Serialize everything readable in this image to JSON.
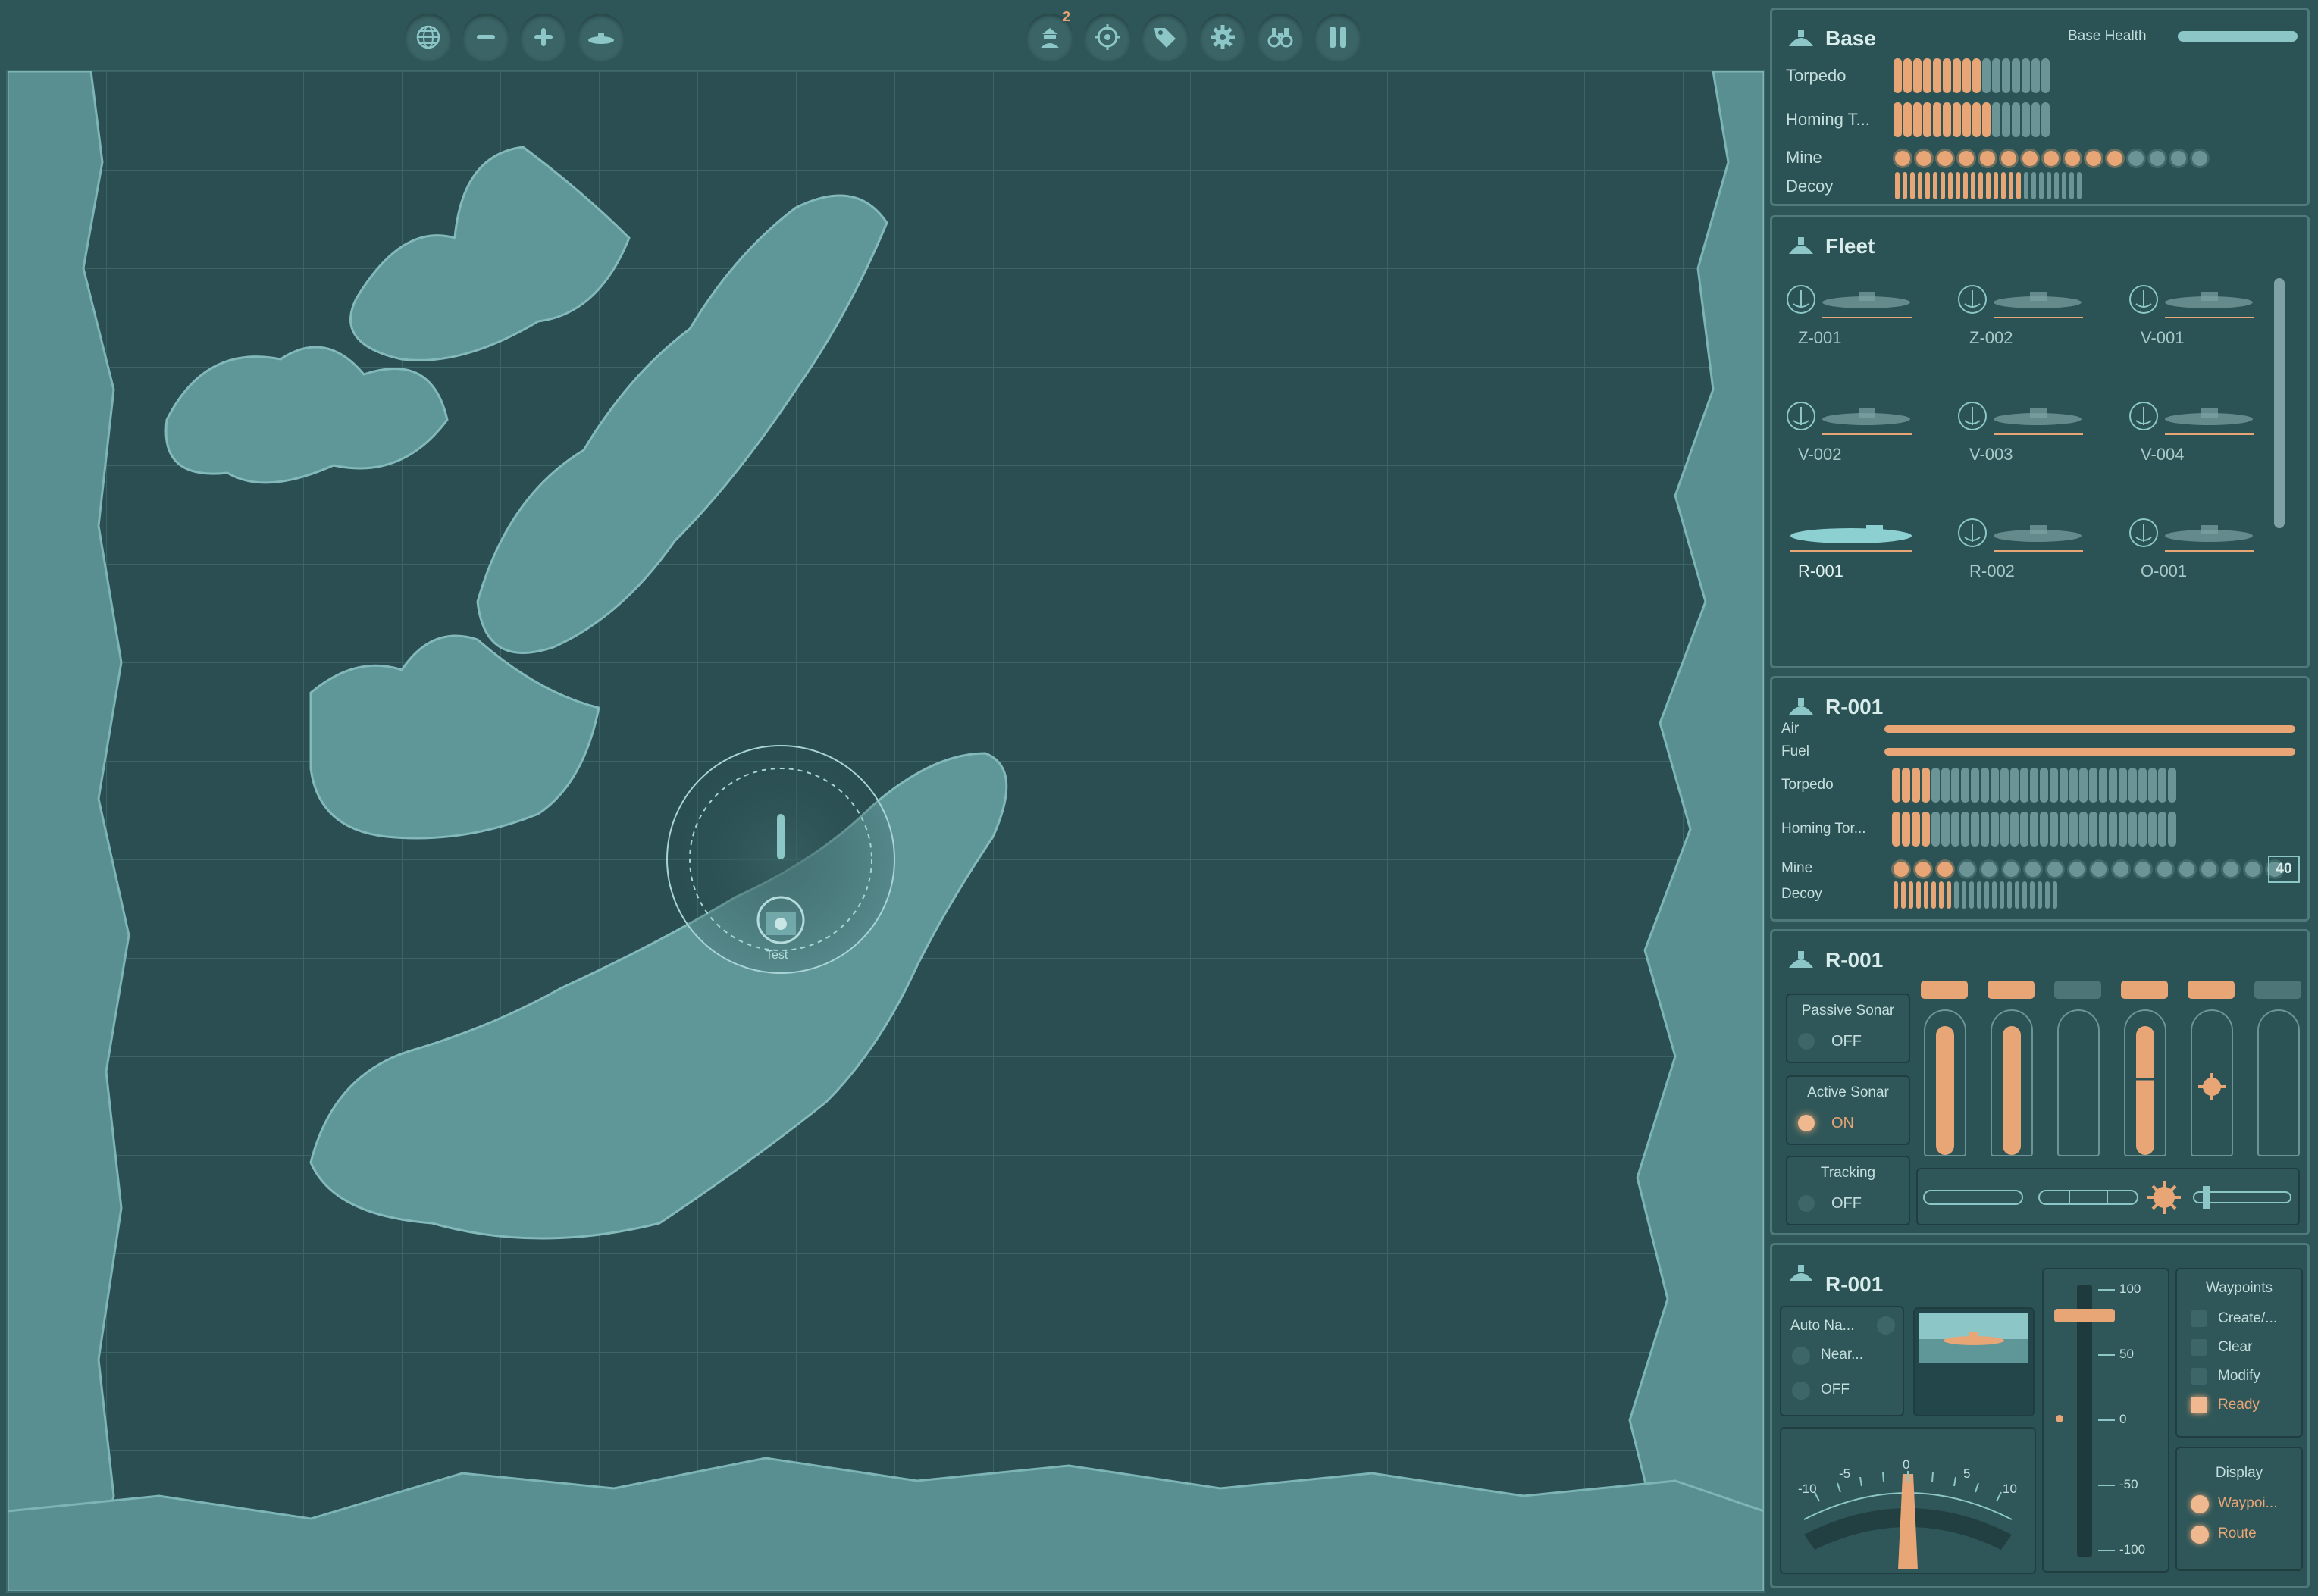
{
  "toolbar": {
    "left_icons": [
      "globe-icon",
      "zoom-out-icon",
      "zoom-in-icon",
      "submarine-icon"
    ],
    "right_icons": [
      "captain-icon",
      "target-icon",
      "tag-icon",
      "gear-icon",
      "binoculars-icon",
      "pause-icon"
    ],
    "captain_badge": "2"
  },
  "map": {
    "unit_label": "Test"
  },
  "base": {
    "title": "Base",
    "health_label": "Base Health",
    "health": 1.0,
    "rows": [
      {
        "label": "Torpedo",
        "total": 16,
        "loaded": 9
      },
      {
        "label": "Homing T...",
        "total": 16,
        "loaded": 10
      },
      {
        "label": "Mine",
        "total": 15,
        "loaded": 11
      },
      {
        "label": "Decoy",
        "total": 25,
        "loaded": 17
      }
    ]
  },
  "fleet": {
    "title": "Fleet",
    "units": [
      {
        "name": "Z-001"
      },
      {
        "name": "Z-002"
      },
      {
        "name": "V-001"
      },
      {
        "name": "V-002"
      },
      {
        "name": "V-003"
      },
      {
        "name": "V-004"
      },
      {
        "name": "R-001",
        "selected": true
      },
      {
        "name": "R-002"
      },
      {
        "name": "O-001"
      }
    ]
  },
  "status": {
    "title": "R-001",
    "air_label": "Air",
    "air": 1.0,
    "fuel_label": "Fuel",
    "fuel": 1.0,
    "torpedo_label": "Torpedo",
    "torpedo_total": 29,
    "torpedo_loaded": 4,
    "homing_label": "Homing Tor...",
    "homing_total": 29,
    "homing_loaded": 4,
    "mine_label": "Mine",
    "mine_total": 18,
    "mine_loaded": 3,
    "mine_count": "40",
    "decoy_label": "Decoy",
    "decoy_total": 22,
    "decoy_loaded": 8
  },
  "weapons": {
    "title": "R-001",
    "passive_label": "Passive Sonar",
    "passive_state": "OFF",
    "active_label": "Active Sonar",
    "active_state": "ON",
    "tracking_label": "Tracking",
    "tracking_state": "OFF",
    "tubes": [
      {
        "state": "loaded",
        "payload": "torpedo"
      },
      {
        "state": "loaded",
        "payload": "torpedo"
      },
      {
        "state": "empty",
        "payload": ""
      },
      {
        "state": "loaded",
        "payload": "homing"
      },
      {
        "state": "loaded",
        "payload": "mine"
      },
      {
        "state": "empty",
        "payload": ""
      }
    ],
    "selector": [
      "torpedo",
      "homing-torpedo",
      "mine",
      "decoy"
    ]
  },
  "nav": {
    "title": "R-001",
    "auto_nav_label": "Auto Na...",
    "near_label": "Near...",
    "off_label": "OFF",
    "depth_ticks": [
      "100",
      "50",
      "0",
      "-50",
      "-100"
    ],
    "gauge_ticks": [
      "-10",
      "-5",
      "0",
      "5",
      "10"
    ],
    "waypoints_title": "Waypoints",
    "waypoints": [
      {
        "label": "Create/...",
        "checked": false
      },
      {
        "label": "Clear",
        "checked": false
      },
      {
        "label": "Modify",
        "checked": false
      },
      {
        "label": "Ready",
        "checked": true
      }
    ],
    "display_title": "Display",
    "display": [
      {
        "label": "Waypoi...",
        "on": true
      },
      {
        "label": "Route",
        "on": true
      }
    ]
  },
  "colors": {
    "accent": "#e8a576",
    "panel": "#2b5254",
    "map": "#2a4e51",
    "land": "#5f9698"
  }
}
